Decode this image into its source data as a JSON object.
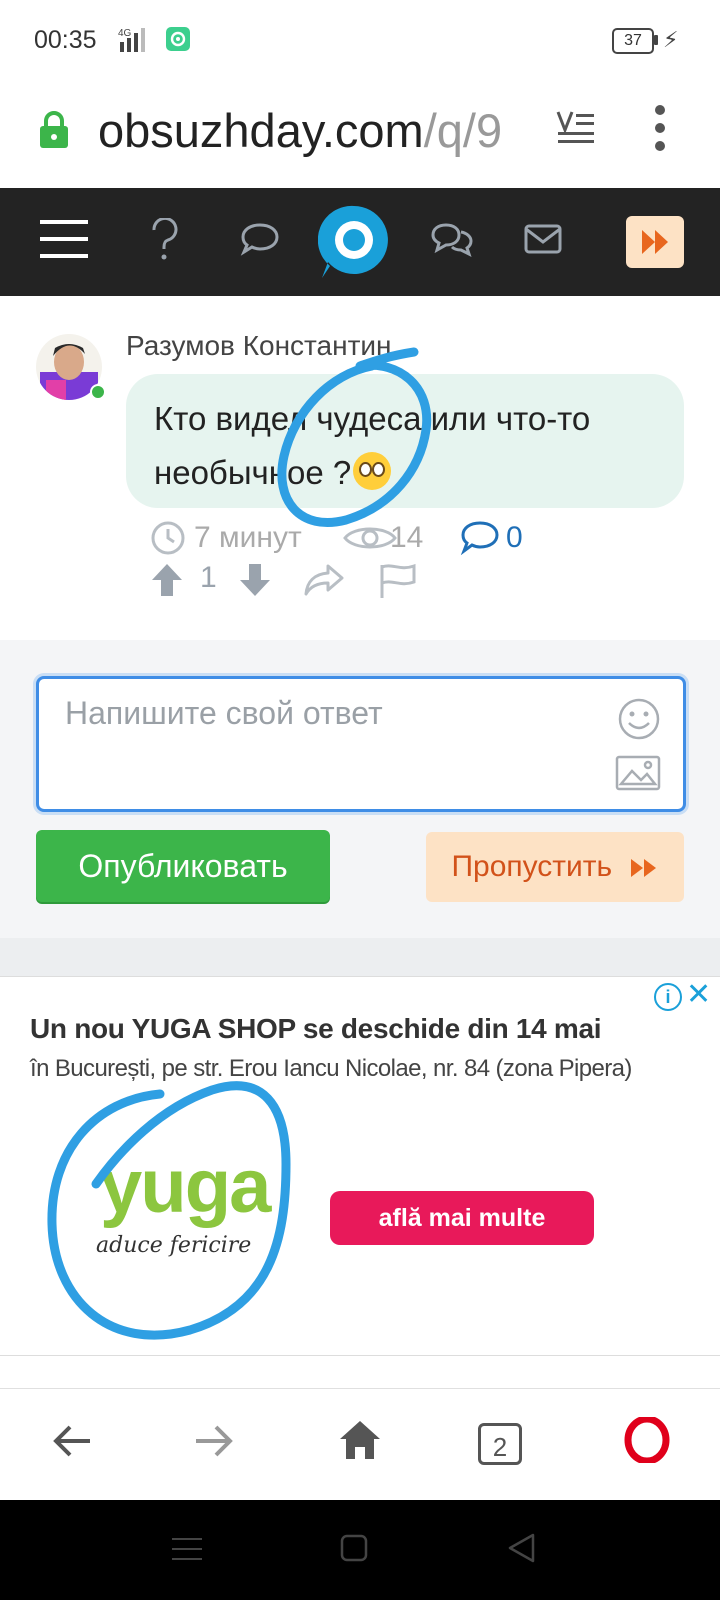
{
  "status_bar": {
    "time": "00:35",
    "network": "4G",
    "battery": "37"
  },
  "url_bar": {
    "host": "obsuzhday.com",
    "path": "/q/9"
  },
  "site_nav": {
    "items": [
      "menu-icon",
      "question-icon",
      "comment-icon",
      "logo-icon",
      "discussions-icon",
      "mail-icon",
      "fast-forward-icon"
    ],
    "accent_color": "#fde2c5"
  },
  "question": {
    "author": "Разумов Константин",
    "text": "Кто видел чудеса или что-то необычное ?",
    "time": "7 минут",
    "views": "14",
    "comments": "0",
    "votes": "1"
  },
  "answer": {
    "placeholder": "Напишите свой ответ",
    "publish_label": "Опубликовать",
    "skip_label": "Пропустить",
    "publish_color": "#3cb54a",
    "skip_text_color": "#d2521a"
  },
  "ad": {
    "title": "Un nou YUGA SHOP se deschide din 14 mai",
    "subtitle": "în București, pe str. Erou Iancu Nicolae, nr. 84 (zona Pipera)",
    "logo_word": "yuga",
    "logo_tagline": "aduce fericire",
    "cta": "află mai multe",
    "cta_color": "#e8195a",
    "logo_color": "#8cc63f"
  },
  "browser_bar": {
    "tabs_count": "2"
  }
}
